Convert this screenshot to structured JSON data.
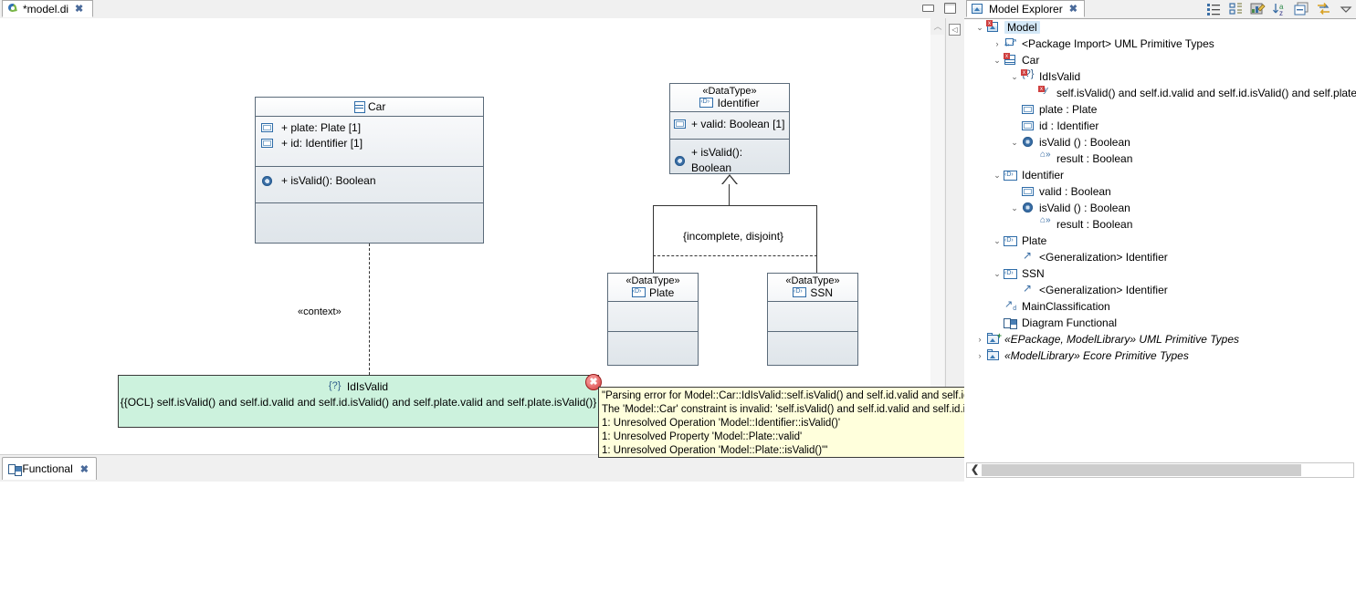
{
  "editor": {
    "tab": {
      "label": "*model.di",
      "icon": "papyrus-icon",
      "close": "✖"
    },
    "window_controls": {
      "minimize": "minimize",
      "maximize": "maximize"
    },
    "bottom_tab": {
      "label": "Functional",
      "icon": "diagram-icon",
      "close": "✖"
    },
    "scroll_left_arrow": "«"
  },
  "diagram": {
    "car_class": {
      "name": "Car",
      "attributes": [
        "+ plate: Plate [1]",
        "+ id: Identifier [1]"
      ],
      "operations": [
        "+ isValid(): Boolean"
      ]
    },
    "identifier_type": {
      "stereotype": "«DataType»",
      "name": "Identifier",
      "attributes": [
        "+ valid: Boolean [1]"
      ],
      "operations": [
        "+ isValid(): Boolean"
      ]
    },
    "plate_type": {
      "stereotype": "«DataType»",
      "name": "Plate"
    },
    "ssn_type": {
      "stereotype": "«DataType»",
      "name": "SSN"
    },
    "generalization_set_label": "{incomplete, disjoint}",
    "context_label": "«context»",
    "constraint": {
      "icon": "{?}",
      "name": "IdIsValid",
      "body": "{{OCL} self.isValid() and self.id.valid and self.id.isValid() and self.plate.valid and self.plate.isValid()}",
      "error_marker": "✖"
    }
  },
  "tooltip": {
    "lines": [
      "\"Parsing error for Model::Car::IdIsValid::self.isValid() and self.id.valid and self.id.isValid() and self.plate.valid and self.plate.isValid():",
      "The 'Model::Car' constraint is invalid: 'self.isValid() and self.id.valid and self.id.isValid() and self.plate.valid and self.plate.isValid()'",
      "1: Unresolved Operation 'Model::Identifier::isValid()'",
      "1: Unresolved Property 'Model::Plate::valid'",
      "1: Unresolved Operation 'Model::Plate::isValid()'\""
    ]
  },
  "explorer": {
    "tab": {
      "label": "Model Explorer",
      "icon": "model-explorer-icon",
      "close": "✖"
    },
    "toolbar": [
      {
        "name": "show-outline-icon"
      },
      {
        "name": "filter-tree-icon"
      },
      {
        "name": "validate-icon"
      },
      {
        "name": "sort-az-icon"
      },
      {
        "name": "collapse-all-icon"
      },
      {
        "name": "link-with-editor-icon"
      },
      {
        "name": "view-menu-icon"
      }
    ],
    "tree": [
      {
        "indent": 0,
        "twisty": "v",
        "icon": "model",
        "label": "Model",
        "selected": true
      },
      {
        "indent": 1,
        "twisty": ">",
        "icon": "pkgimport",
        "label": "<Package Import> UML Primitive Types"
      },
      {
        "indent": 1,
        "twisty": "v",
        "icon": "class",
        "label": "Car"
      },
      {
        "indent": 2,
        "twisty": "v",
        "icon": "constraint",
        "label": "IdIsValid"
      },
      {
        "indent": 3,
        "twisty": "",
        "icon": "ocl",
        "label": "self.isValid() and self.id.valid and self.id.isValid() and self.plate.v"
      },
      {
        "indent": 2,
        "twisty": "",
        "icon": "prop",
        "label": "plate : Plate"
      },
      {
        "indent": 2,
        "twisty": "",
        "icon": "prop",
        "label": "id : Identifier"
      },
      {
        "indent": 2,
        "twisty": "v",
        "icon": "op",
        "label": "isValid () : Boolean"
      },
      {
        "indent": 3,
        "twisty": "",
        "icon": "param",
        "label": "result : Boolean"
      },
      {
        "indent": 1,
        "twisty": "v",
        "icon": "datatype",
        "label": "Identifier"
      },
      {
        "indent": 2,
        "twisty": "",
        "icon": "prop",
        "label": "valid : Boolean"
      },
      {
        "indent": 2,
        "twisty": "v",
        "icon": "op",
        "label": "isValid () : Boolean"
      },
      {
        "indent": 3,
        "twisty": "",
        "icon": "param",
        "label": "result : Boolean"
      },
      {
        "indent": 1,
        "twisty": "v",
        "icon": "datatype",
        "label": "Plate"
      },
      {
        "indent": 2,
        "twisty": "",
        "icon": "gen",
        "label": "<Generalization> Identifier"
      },
      {
        "indent": 1,
        "twisty": "v",
        "icon": "datatype",
        "label": "SSN"
      },
      {
        "indent": 2,
        "twisty": "",
        "icon": "gen",
        "label": "<Generalization> Identifier"
      },
      {
        "indent": 1,
        "twisty": "",
        "icon": "mainclass",
        "label": "MainClassification"
      },
      {
        "indent": 1,
        "twisty": "",
        "icon": "diagram",
        "label": "Diagram Functional"
      },
      {
        "indent": 0,
        "twisty": ">",
        "icon": "package",
        "label": "«EPackage, ModelLibrary» UML Primitive Types",
        "italic": true
      },
      {
        "indent": 0,
        "twisty": ">",
        "icon": "package2",
        "label": "«ModelLibrary» Ecore Primitive Types",
        "italic": true
      }
    ],
    "hscroll_left_arrow": "❮"
  },
  "colors": {
    "constraint_green": "#ccf2dd",
    "tooltip_yellow": "#ffffdc",
    "selection_blue": "#d4e8f7",
    "error_red": "#d13b3b"
  }
}
